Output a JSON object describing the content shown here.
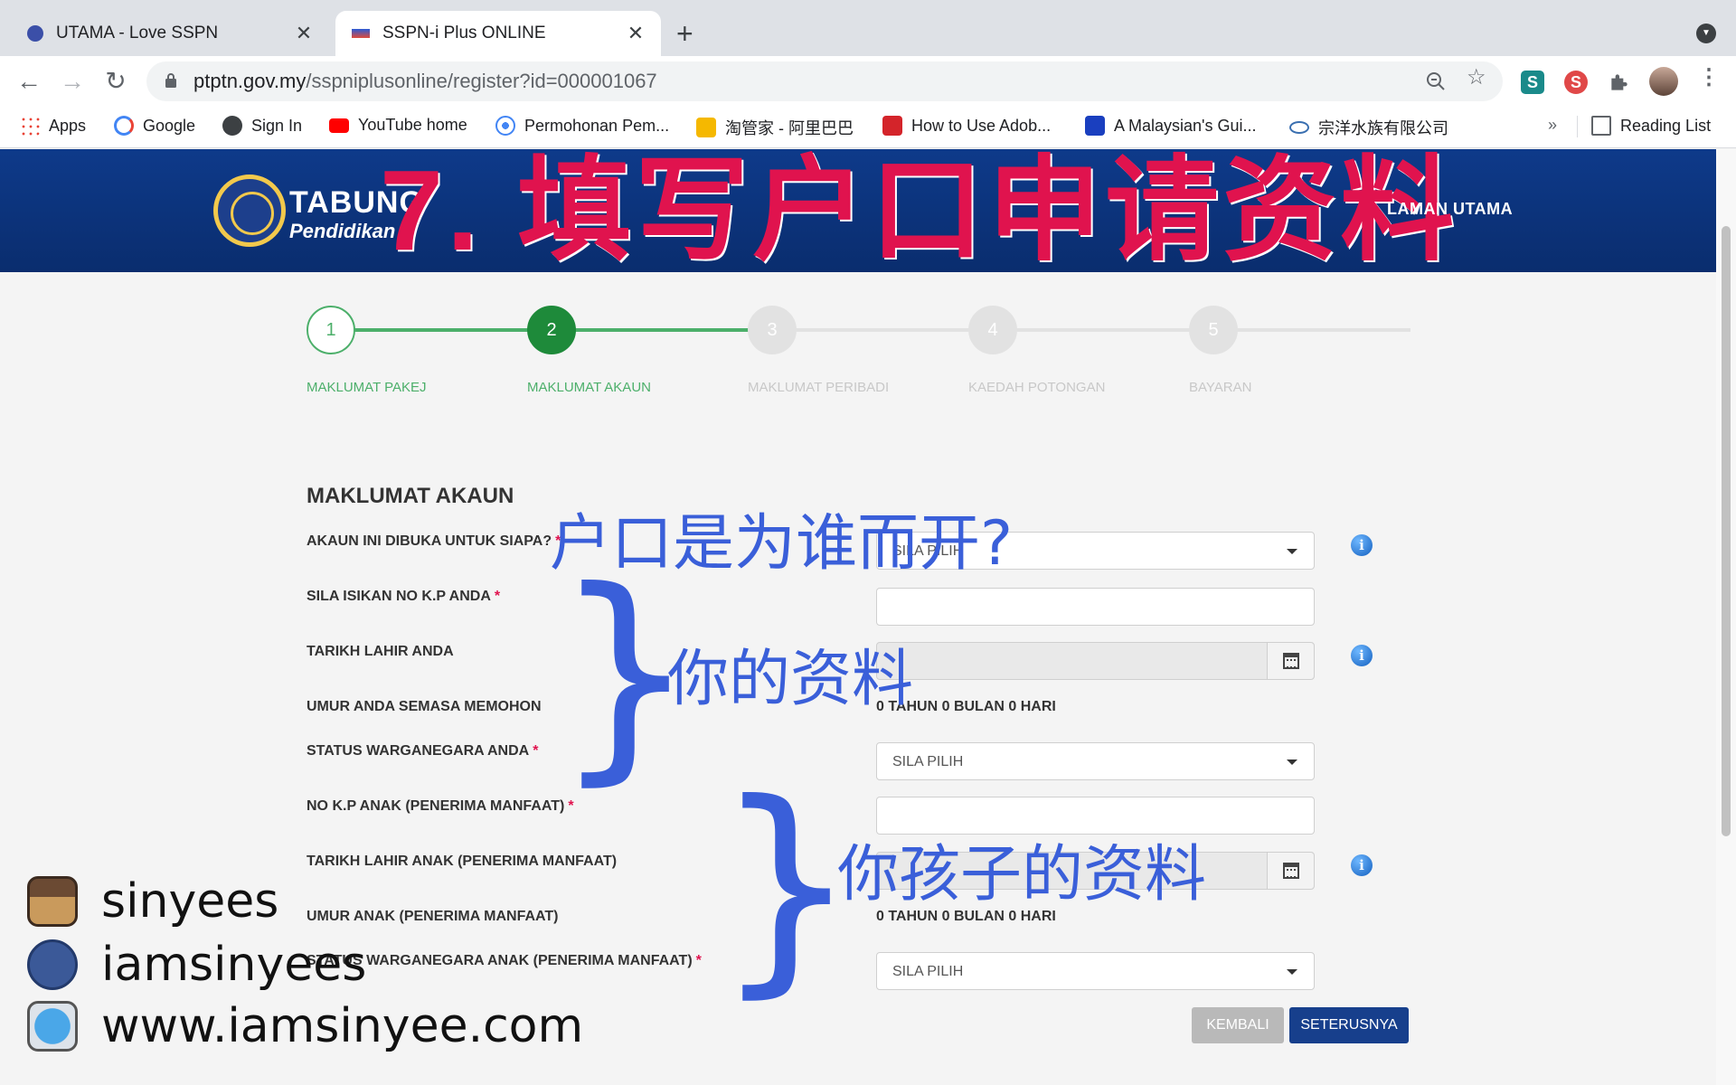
{
  "browser": {
    "tabs": [
      {
        "title": "UTAMA - Love SSPN",
        "close": "✕"
      },
      {
        "title": "SSPN-i Plus ONLINE",
        "close": "✕"
      }
    ],
    "new_tab": "+",
    "url_host": "ptptn.gov.my",
    "url_path": "/sspniplusonline/register?id=000001067",
    "bookmarks": [
      {
        "label": "Apps"
      },
      {
        "label": "Google"
      },
      {
        "label": "Sign In"
      },
      {
        "label": "YouTube home"
      },
      {
        "label": "Permohonan Pem..."
      },
      {
        "label": "淘管家 - 阿里巴巴"
      },
      {
        "label": "How to Use Adob..."
      },
      {
        "label": "A Malaysian's Gui..."
      },
      {
        "label": "宗洋水族有限公司"
      }
    ],
    "bookmarks_overflow": "»",
    "reading_list": "Reading List",
    "extension_s1": "S",
    "extension_s2": "S"
  },
  "banner": {
    "logo_line1": "TABUNG",
    "logo_line2": "Pendidikan",
    "heading": "7. 填写户口申请资料",
    "nav_home": "LAMAN UTAMA"
  },
  "stepper": [
    {
      "num": "1",
      "label": "MAKLUMAT PAKEJ",
      "state": "done"
    },
    {
      "num": "2",
      "label": "MAKLUMAT AKAUN",
      "state": "current"
    },
    {
      "num": "3",
      "label": "MAKLUMAT PERIBADI",
      "state": "todo"
    },
    {
      "num": "4",
      "label": "KAEDAH POTONGAN",
      "state": "todo"
    },
    {
      "num": "5",
      "label": "BAYARAN",
      "state": "todo"
    }
  ],
  "form": {
    "title": "MAKLUMAT AKAUN",
    "account_for_label": "AKAUN INI DIBUKA UNTUK SIAPA?",
    "account_for_value": "SILA PILIH",
    "ic_label": "SILA ISIKAN NO K.P ANDA",
    "ic_value": "",
    "dob_label": "TARIKH LAHIR ANDA",
    "age_label": "UMUR ANDA SEMASA MEMOHON",
    "age_value": "0 TAHUN 0 BULAN 0 HARI",
    "citizen_label": "STATUS WARGANEGARA ANDA",
    "citizen_value": "SILA PILIH",
    "child_ic_label": "NO K.P ANAK (PENERIMA MANFAAT)",
    "child_ic_value": "",
    "child_dob_label": "TARIKH LAHIR ANAK (PENERIMA MANFAAT)",
    "child_age_label": "UMUR ANAK (PENERIMA MANFAAT)",
    "child_age_value": "0 TAHUN 0 BULAN 0 HARI",
    "child_citizen_label": "STATUS WARGANEGARA ANAK (PENERIMA MANFAAT)",
    "child_citizen_value": "SILA PILIH",
    "required_mark": "*",
    "info_glyph": "i",
    "back_button": "KEMBALI",
    "next_button": "SETERUSNYA"
  },
  "annotations": {
    "q_account_for": "户口是为谁而开?",
    "your_info": "你的资料",
    "child_info": "你孩子的资料",
    "brace": "}"
  },
  "social": {
    "instagram": "sinyees",
    "facebook": "iamsinyees",
    "website": "www.iamsinyee.com"
  },
  "colors": {
    "banner_blue": "#0e3a8a",
    "heading_red": "#e0134e",
    "step_green": "#1e8a3a",
    "step_light_green": "#4caf6a",
    "annotation_blue": "#3a5fd9",
    "next_button": "#173f8c"
  }
}
